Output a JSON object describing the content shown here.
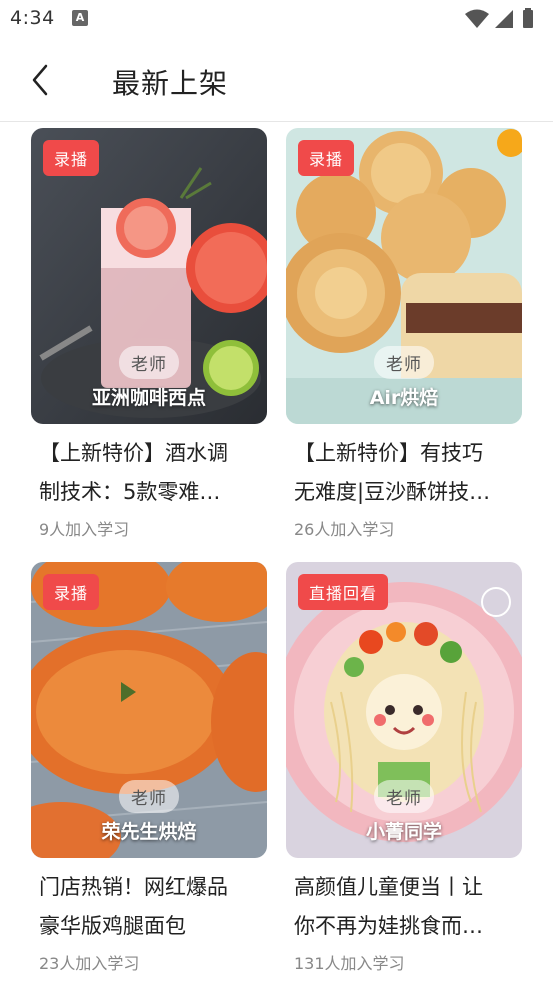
{
  "status_bar": {
    "time": "4:34",
    "notification_glyph": "A"
  },
  "header": {
    "title": "最新上架"
  },
  "courses": [
    {
      "badge": "录播",
      "role": "老师",
      "teacher": "亚洲咖啡西点",
      "title_line1": "【上新特价】酒水调",
      "title_line2": "制技术：5款零难…",
      "learners": "9人加入学习"
    },
    {
      "badge": "录播",
      "role": "老师",
      "teacher": "Air烘焙",
      "title_line1": "【上新特价】有技巧",
      "title_line2": "无难度|豆沙酥饼技…",
      "learners": "26人加入学习"
    },
    {
      "badge": "录播",
      "role": "老师",
      "teacher": "荣先生烘焙",
      "title_line1": "门店热销！网红爆品",
      "title_line2": "豪华版鸡腿面包",
      "learners": "23人加入学习"
    },
    {
      "badge": "直播回看",
      "role": "老师",
      "teacher": "小菁同学",
      "title_line1": "高颜值儿童便当丨让",
      "title_line2": "你不再为娃挑食而…",
      "learners": "131人加入学习"
    }
  ],
  "colors": {
    "badge": "#f04a4a",
    "text_primary": "#222222",
    "text_secondary": "#888888"
  }
}
